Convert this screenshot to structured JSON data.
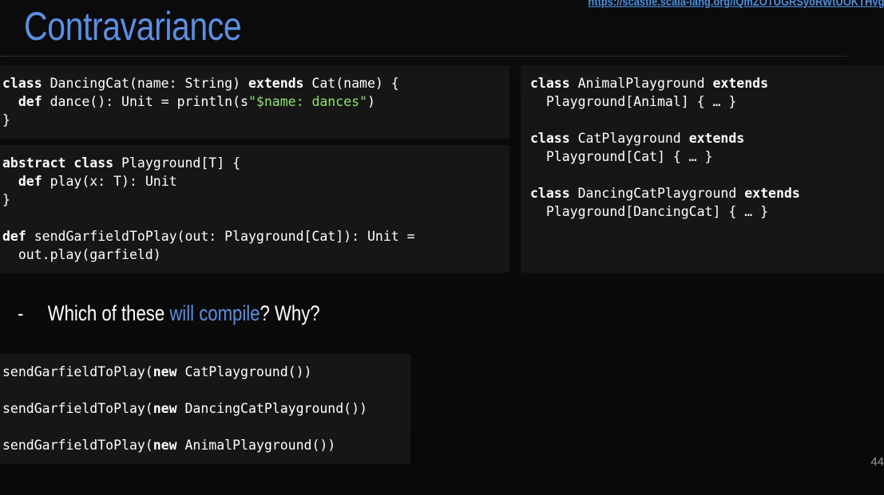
{
  "title": "Contravariance",
  "link": "https://scastie.scala-lang.org/IQmZOTUGRSyoRWtUOKTHvg",
  "page_number": "44",
  "colors": {
    "title": "#5b8fe3",
    "link": "#4a90e2",
    "string_literal": "#8fe36a",
    "code_background": "#161616",
    "slide_background": "#0b0b0b"
  },
  "box1": {
    "l1_kw1": "class",
    "l1_t1": " DancingCat(name: String) ",
    "l1_kw2": "extends",
    "l1_t2": " Cat(name) {",
    "l2_indent": "  ",
    "l2_kw": "def",
    "l2_t": " dance(): Unit = println(s",
    "l2_str": "\"$name: dances\"",
    "l2_end": ")",
    "l3": "}"
  },
  "box2": {
    "l1_kw1": "abstract",
    "l1_sp": " ",
    "l1_kw2": "class",
    "l1_t": " Playground[T] {",
    "l2_indent": "  ",
    "l2_kw": "def",
    "l2_t": " play(x: T): Unit",
    "l3": "}",
    "l4_kw": "def",
    "l4_t": " sendGarfieldToPlay(out: Playground[Cat]): Unit =",
    "l5": "  out.play(garfield)"
  },
  "box3": {
    "a_kw1": "class",
    "a_t1": " AnimalPlayground ",
    "a_kw2": "extends",
    "a_l2": "  Playground[Animal] { … }",
    "b_kw1": "class",
    "b_t1": " CatPlayground ",
    "b_kw2": "extends",
    "b_l2": "  Playground[Cat] { … }",
    "c_kw1": "class",
    "c_t1": " DancingCatPlayground ",
    "c_kw2": "extends",
    "c_l2": "  Playground[DancingCat] { … }"
  },
  "bullet": {
    "dash": "-",
    "before": "Which of these ",
    "highlight": "will compile",
    "after": "? Why?"
  },
  "calls": [
    {
      "pre": "sendGarfieldToPlay(",
      "kw": "new",
      "post": " CatPlayground())"
    },
    {
      "pre": "sendGarfieldToPlay(",
      "kw": "new",
      "post": " DancingCatPlayground())"
    },
    {
      "pre": "sendGarfieldToPlay(",
      "kw": "new",
      "post": " AnimalPlayground())"
    }
  ]
}
